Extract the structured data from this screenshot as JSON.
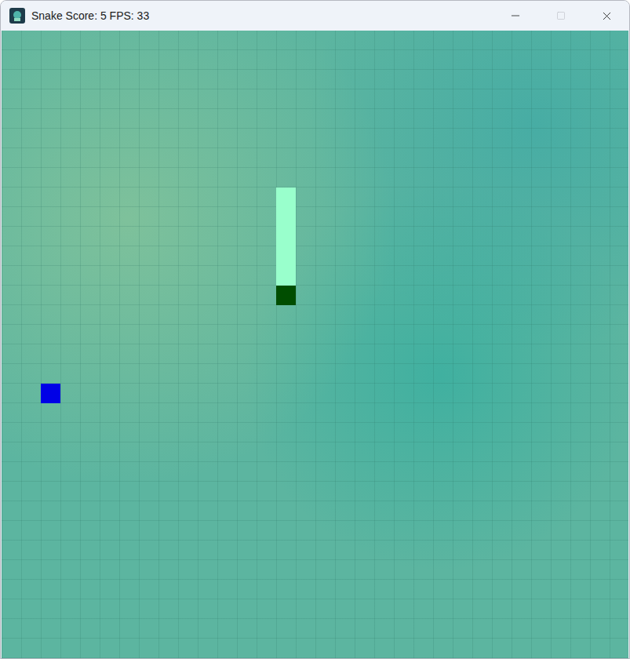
{
  "window": {
    "title": "Snake Score: 5 FPS: 33",
    "controls": [
      {
        "kind": "minimize",
        "disabled": false
      },
      {
        "kind": "maximize",
        "disabled": true
      },
      {
        "kind": "close",
        "disabled": false
      }
    ]
  },
  "board": {
    "cols": 32,
    "rows": 32
  },
  "snake": [
    {
      "kind": "body",
      "col": 14,
      "row": 8,
      "color": "#99ffcc"
    },
    {
      "kind": "body",
      "col": 14,
      "row": 9,
      "color": "#99ffcc"
    },
    {
      "kind": "body",
      "col": 14,
      "row": 10,
      "color": "#99ffcc"
    },
    {
      "kind": "body",
      "col": 14,
      "row": 11,
      "color": "#99ffcc"
    },
    {
      "kind": "body",
      "col": 14,
      "row": 12,
      "color": "#99ffcc"
    },
    {
      "kind": "head",
      "col": 14,
      "row": 13,
      "color": "#004d00"
    }
  ],
  "food": {
    "col": 2,
    "row": 18,
    "color": "#0000e6"
  }
}
